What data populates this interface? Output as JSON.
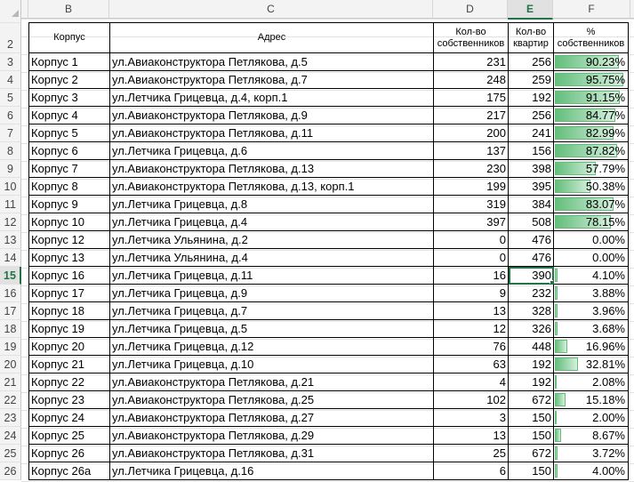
{
  "columns": {
    "b": "B",
    "c": "C",
    "d": "D",
    "e": "E",
    "f": "F",
    "selected": "E"
  },
  "row_numbers": [
    "2",
    "3",
    "4",
    "5",
    "6",
    "7",
    "8",
    "9",
    "10",
    "11",
    "12",
    "13",
    "14",
    "15",
    "16",
    "17",
    "18",
    "19",
    "20",
    "21",
    "22",
    "23",
    "24",
    "25",
    "26"
  ],
  "selected_row": "15",
  "headers": {
    "korpus": "Корпус",
    "address": "Адрес",
    "owners": "Кол-во собственников",
    "apartments": "Кол-во квартир",
    "percent": "% собственников"
  },
  "rows": [
    {
      "korpus": "Корпус 1",
      "address": "ул.Авиаконструктора Петлякова, д.5",
      "owners": "231",
      "apartments": "256",
      "percent": "90.23%",
      "fraction": 0.9023
    },
    {
      "korpus": "Корпус 2",
      "address": "ул.Авиаконструктора Петлякова, д.7",
      "owners": "248",
      "apartments": "259",
      "percent": "95.75%",
      "fraction": 0.9575
    },
    {
      "korpus": "Корпус 3",
      "address": "ул.Летчика Грицевца, д.4, корп.1",
      "owners": "175",
      "apartments": "192",
      "percent": "91.15%",
      "fraction": 0.9115
    },
    {
      "korpus": "Корпус 4",
      "address": "ул.Авиаконструктора Петлякова, д.9",
      "owners": "217",
      "apartments": "256",
      "percent": "84.77%",
      "fraction": 0.8477
    },
    {
      "korpus": "Корпус 5",
      "address": "ул.Авиаконструктора Петлякова, д.11",
      "owners": "200",
      "apartments": "241",
      "percent": "82.99%",
      "fraction": 0.8299
    },
    {
      "korpus": "Корпус 6",
      "address": "ул.Летчика Грицевца, д.6",
      "owners": "137",
      "apartments": "156",
      "percent": "87.82%",
      "fraction": 0.8782
    },
    {
      "korpus": "Корпус 7",
      "address": "ул.Авиаконструктора Петлякова, д.13",
      "owners": "230",
      "apartments": "398",
      "percent": "57.79%",
      "fraction": 0.5779
    },
    {
      "korpus": "Корпус 8",
      "address": "ул.Авиаконструктора Петлякова, д.13, корп.1",
      "owners": "199",
      "apartments": "395",
      "percent": "50.38%",
      "fraction": 0.5038
    },
    {
      "korpus": "Корпус 9",
      "address": "ул.Летчика Грицевца, д.8",
      "owners": "319",
      "apartments": "384",
      "percent": "83.07%",
      "fraction": 0.8307
    },
    {
      "korpus": "Корпус 10",
      "address": "ул.Летчика Грицевца, д.4",
      "owners": "397",
      "apartments": "508",
      "percent": "78.15%",
      "fraction": 0.7815
    },
    {
      "korpus": "Корпус 12",
      "address": "ул.Летчика Ульянина, д.2",
      "owners": "0",
      "apartments": "476",
      "percent": "0.00%",
      "fraction": 0
    },
    {
      "korpus": "Корпус 13",
      "address": "ул.Летчика Ульянина, д.4",
      "owners": "0",
      "apartments": "476",
      "percent": "0.00%",
      "fraction": 0
    },
    {
      "korpus": "Корпус 16",
      "address": "ул.Летчика Грицевца, д.11",
      "owners": "16",
      "apartments": "390",
      "percent": "4.10%",
      "fraction": 0.041
    },
    {
      "korpus": "Корпус 17",
      "address": "ул.Летчика Грицевца, д.9",
      "owners": "9",
      "apartments": "232",
      "percent": "3.88%",
      "fraction": 0.0388
    },
    {
      "korpus": "Корпус 18",
      "address": "ул.Летчика Грицевца, д.7",
      "owners": "13",
      "apartments": "328",
      "percent": "3.96%",
      "fraction": 0.0396
    },
    {
      "korpus": "Корпус 19",
      "address": "ул.Летчика Грицевца, д.5",
      "owners": "12",
      "apartments": "326",
      "percent": "3.68%",
      "fraction": 0.0368
    },
    {
      "korpus": "Корпус 20",
      "address": "ул.Летчика Грицевца, д.12",
      "owners": "76",
      "apartments": "448",
      "percent": "16.96%",
      "fraction": 0.1696
    },
    {
      "korpus": "Корпус 21",
      "address": "ул.Летчика Грицевца, д.10",
      "owners": "63",
      "apartments": "192",
      "percent": "32.81%",
      "fraction": 0.3281
    },
    {
      "korpus": "Корпус 22",
      "address": "ул.Авиаконструктора Петлякова, д.21",
      "owners": "4",
      "apartments": "192",
      "percent": "2.08%",
      "fraction": 0.0208
    },
    {
      "korpus": "Корпус 23",
      "address": "ул.Авиаконструктора Петлякова, д.25",
      "owners": "102",
      "apartments": "672",
      "percent": "15.18%",
      "fraction": 0.1518
    },
    {
      "korpus": "Корпус 24",
      "address": "ул.Авиаконструктора Петлякова, д.27",
      "owners": "3",
      "apartments": "150",
      "percent": "2.00%",
      "fraction": 0.02
    },
    {
      "korpus": "Корпус 25",
      "address": "ул.Авиаконструктора Петлякова, д.29",
      "owners": "13",
      "apartments": "150",
      "percent": "8.67%",
      "fraction": 0.0867
    },
    {
      "korpus": "Корпус 26",
      "address": "ул.Авиаконструктора Петлякова, д.31",
      "owners": "25",
      "apartments": "672",
      "percent": "3.72%",
      "fraction": 0.0372
    },
    {
      "korpus": "Корпус 26а",
      "address": "ул.Летчика Грицевца, д.16",
      "owners": "6",
      "apartments": "150",
      "percent": "4.00%",
      "fraction": 0.04
    }
  ],
  "selected_cell": {
    "row": "15",
    "column": "E"
  },
  "colors": {
    "databar": "#63be7b",
    "selection": "#217346"
  }
}
